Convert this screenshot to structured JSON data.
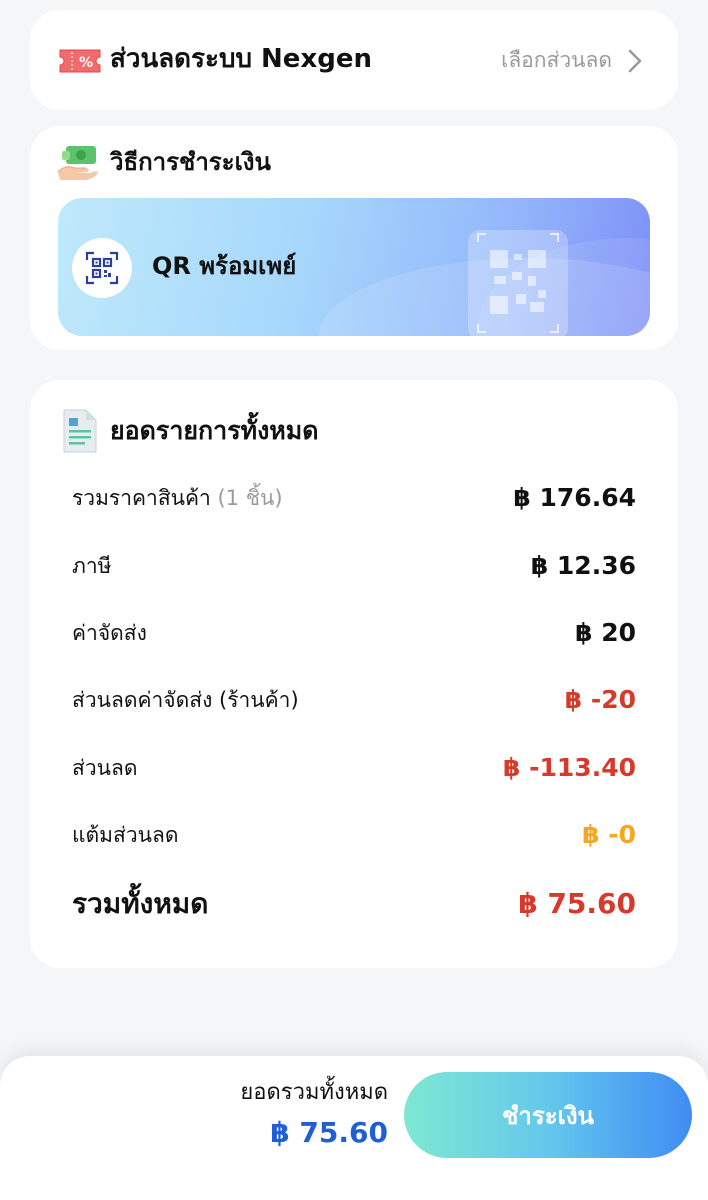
{
  "discount": {
    "title": "ส่วนลดระบบ Nexgen",
    "select_label": "เลือกส่วนลด"
  },
  "payment": {
    "title": "วิธีการชำระเงิน",
    "method_label": "QR พร้อมเพย์"
  },
  "summary": {
    "title": "ยอดรายการทั้งหมด",
    "rows": [
      {
        "label": "รวมราคาสินค้า",
        "qty": "(1 ชิ้น)",
        "value": "฿ 176.64"
      },
      {
        "label": "ภาษี",
        "value": "฿ 12.36"
      },
      {
        "label": "ค่าจัดส่ง",
        "value": "฿ 20"
      },
      {
        "label": "ส่วนลดค่าจัดส่ง (ร้านค้า)",
        "value": "฿ -20"
      },
      {
        "label": "ส่วนลด",
        "value": "฿ -113.40"
      },
      {
        "label": "แต้มส่วนลด",
        "value": "฿ -0"
      }
    ],
    "total": {
      "label": "รวมทั้งหมด",
      "value": "฿ 75.60"
    }
  },
  "footer": {
    "total_label": "ยอดรวมทั้งหมด",
    "total_value": "฿ 75.60",
    "pay_button": "ชำระเงิน"
  },
  "icons": {
    "coupon": "coupon-icon",
    "money": "money-hand-icon",
    "qr": "qr-code-icon",
    "document": "document-icon",
    "chevron": "chevron-right-icon"
  },
  "colors": {
    "negative": "#d63a2a",
    "points": "#f5a623",
    "total_blue": "#1f5ed6",
    "button_start": "#7ee8d2",
    "button_end": "#3f8cf4"
  }
}
